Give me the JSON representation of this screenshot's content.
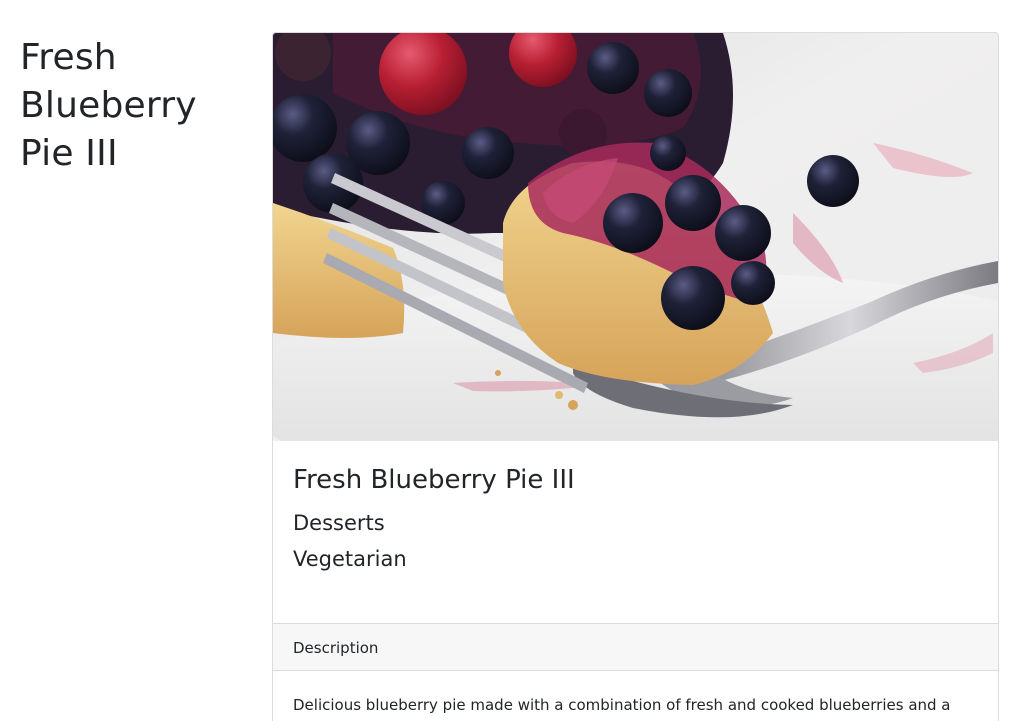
{
  "page": {
    "title": "Fresh Blueberry Pie III"
  },
  "recipe": {
    "title": "Fresh Blueberry Pie III",
    "category": "Desserts",
    "diet": "Vegetarian"
  },
  "description": {
    "header": "Description",
    "text": "Delicious blueberry pie made with a combination of fresh and cooked blueberries and a pre-"
  }
}
